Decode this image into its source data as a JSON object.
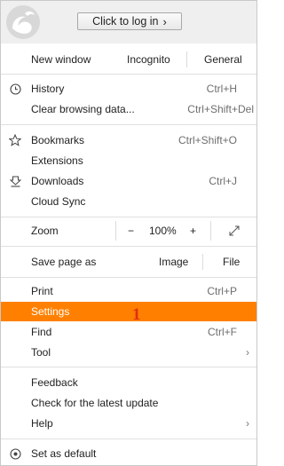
{
  "header": {
    "login_label": "Click to log in",
    "login_arrow": "›"
  },
  "window_row": {
    "new_window": "New window",
    "incognito": "Incognito",
    "general": "General"
  },
  "history": {
    "label": "History",
    "shortcut": "Ctrl+H",
    "icon": "clock-icon"
  },
  "clear_data": {
    "label": "Clear browsing data...",
    "shortcut": "Ctrl+Shift+Del"
  },
  "bookmarks": {
    "label": "Bookmarks",
    "shortcut": "Ctrl+Shift+O",
    "icon": "star-icon"
  },
  "extensions": {
    "label": "Extensions"
  },
  "downloads": {
    "label": "Downloads",
    "shortcut": "Ctrl+J",
    "icon": "download-icon"
  },
  "cloud_sync": {
    "label": "Cloud Sync"
  },
  "zoom": {
    "label": "Zoom",
    "minus": "−",
    "value": "100%",
    "plus": "+",
    "fullscreen_icon": "expand-icon"
  },
  "save": {
    "label": "Save page as",
    "image": "Image",
    "file": "File"
  },
  "print": {
    "label": "Print",
    "shortcut": "Ctrl+P"
  },
  "settings": {
    "label": "Settings",
    "badge": "1",
    "highlight_color": "#ff8000"
  },
  "find": {
    "label": "Find",
    "shortcut": "Ctrl+F"
  },
  "tool": {
    "label": "Tool",
    "arrow": "›"
  },
  "feedback": {
    "label": "Feedback"
  },
  "check_update": {
    "label": "Check for the latest update"
  },
  "help": {
    "label": "Help",
    "arrow": "›"
  },
  "set_default": {
    "label": "Set as default",
    "icon": "target-icon"
  }
}
